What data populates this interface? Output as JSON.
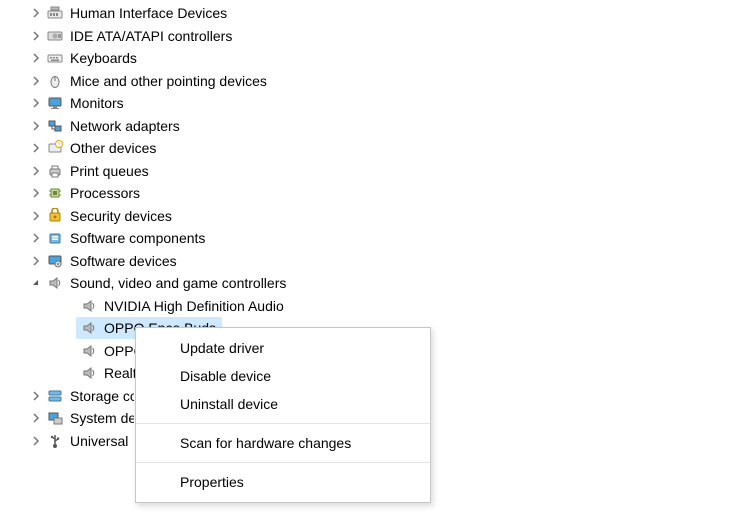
{
  "tree": [
    {
      "label": "Human Interface Devices",
      "iconKey": "hid",
      "state": "collapsed"
    },
    {
      "label": "IDE ATA/ATAPI controllers",
      "iconKey": "ide",
      "state": "collapsed"
    },
    {
      "label": "Keyboards",
      "iconKey": "keyboard",
      "state": "collapsed"
    },
    {
      "label": "Mice and other pointing devices",
      "iconKey": "mouse",
      "state": "collapsed"
    },
    {
      "label": "Monitors",
      "iconKey": "monitor",
      "state": "collapsed"
    },
    {
      "label": "Network adapters",
      "iconKey": "network",
      "state": "collapsed"
    },
    {
      "label": "Other devices",
      "iconKey": "other",
      "state": "collapsed"
    },
    {
      "label": "Print queues",
      "iconKey": "printer",
      "state": "collapsed"
    },
    {
      "label": "Processors",
      "iconKey": "cpu",
      "state": "collapsed"
    },
    {
      "label": "Security devices",
      "iconKey": "security",
      "state": "collapsed"
    },
    {
      "label": "Software components",
      "iconKey": "component",
      "state": "collapsed"
    },
    {
      "label": "Software devices",
      "iconKey": "softdev",
      "state": "collapsed"
    },
    {
      "label": "Sound, video and game controllers",
      "iconKey": "sound",
      "state": "expanded",
      "children": [
        {
          "label": "NVIDIA High Definition Audio",
          "iconKey": "speaker"
        },
        {
          "label": "OPPO Enco Buds",
          "iconKey": "speaker",
          "selected": true
        },
        {
          "label": "OPPO Enco Buds",
          "iconKey": "speaker",
          "truncate": 42
        },
        {
          "label": "Realtek(R) Audio",
          "iconKey": "speaker",
          "truncate": 32
        }
      ]
    },
    {
      "label": "Storage controllers",
      "iconKey": "storage",
      "state": "collapsed",
      "truncate": 62
    },
    {
      "label": "System devices",
      "iconKey": "system",
      "state": "collapsed",
      "truncate": 62
    },
    {
      "label": "Universal Serial Bus controllers",
      "iconKey": "usb",
      "state": "collapsed",
      "truncate": 58
    }
  ],
  "contextMenu": {
    "items1": [
      {
        "label": "Update driver",
        "key": "update"
      },
      {
        "label": "Disable device",
        "key": "disable"
      },
      {
        "label": "Uninstall device",
        "key": "uninstall"
      }
    ],
    "items2": [
      {
        "label": "Scan for hardware changes",
        "key": "scan"
      }
    ],
    "items3": [
      {
        "label": "Properties",
        "key": "properties"
      }
    ]
  }
}
